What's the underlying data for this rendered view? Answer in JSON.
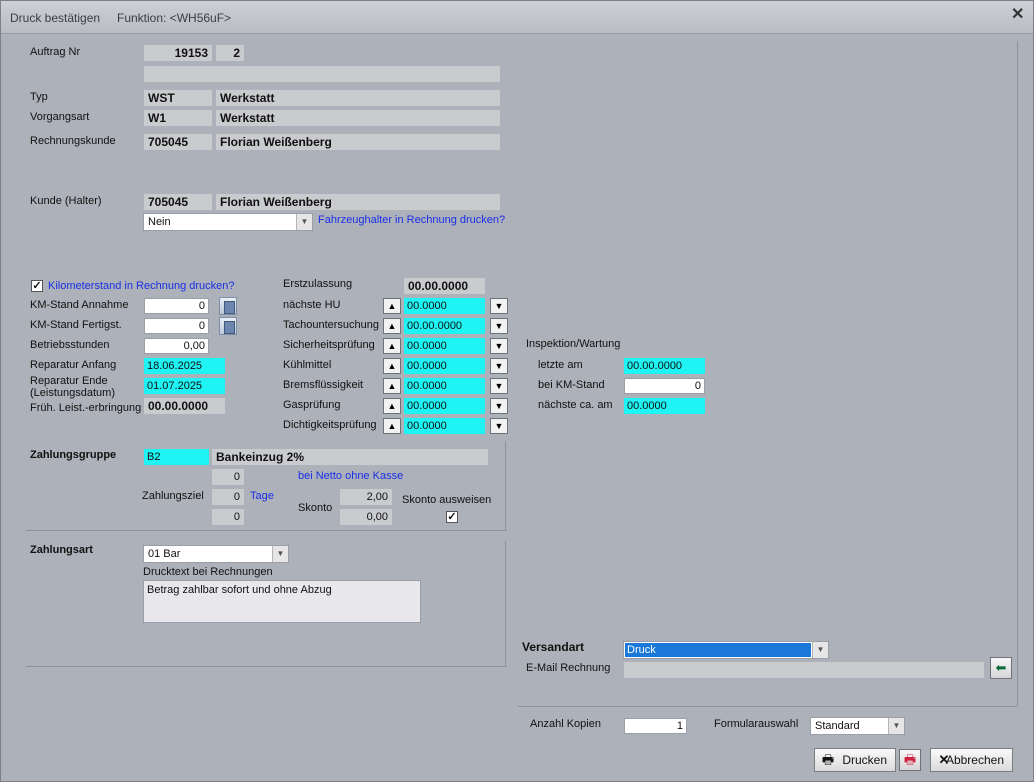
{
  "window": {
    "title": "Druck bestätigen",
    "function": "Funktion: <WH56uF>"
  },
  "auftrag": {
    "label": "Auftrag Nr",
    "nr": "19153",
    "sub": "2"
  },
  "typ": {
    "label": "Typ",
    "code": "WST",
    "name": "Werkstatt"
  },
  "vorgangsart": {
    "label": "Vorgangsart",
    "code": "W1",
    "name": "Werkstatt"
  },
  "rechnungskunde": {
    "label": "Rechnungskunde",
    "nr": "705045",
    "name": "Florian Weißenberg"
  },
  "kunde": {
    "label": "Kunde (Halter)",
    "nr": "705045",
    "name": "Florian Weißenberg",
    "halter_select": "Nein",
    "halter_link": "Fahrzeughalter in Rechnung drucken?"
  },
  "km": {
    "check_label": "Kilometerstand in Rechnung drucken?",
    "annahme_label": "KM-Stand Annahme",
    "annahme": "0",
    "fertig_label": "KM-Stand Fertigst.",
    "fertig": "0",
    "betrieb_label": "Betriebsstunden",
    "betrieb": "0,00",
    "rep_anfang_label": "Reparatur Anfang",
    "rep_anfang": "18.06.2025",
    "rep_ende_label1": "Reparatur Ende",
    "rep_ende_label2": "(Leistungsdatum)",
    "rep_ende": "01.07.2025",
    "frueh_label": "Früh. Leist.-erbringung",
    "frueh": "00.00.0000"
  },
  "pruefungen": {
    "erstzulassung_label": "Erstzulassung",
    "erstzulassung": "00.00.0000",
    "items": [
      {
        "label": "nächste HU",
        "value": "00.0000"
      },
      {
        "label": "Tachountersuchung",
        "value": "00.00.0000"
      },
      {
        "label": "Sicherheitsprüfung",
        "value": "00.0000"
      },
      {
        "label": "Kühlmittel",
        "value": "00.0000"
      },
      {
        "label": "Bremsflüssigkeit",
        "value": "00.0000"
      },
      {
        "label": "Gasprüfung",
        "value": "00.0000"
      },
      {
        "label": "Dichtigkeitsprüfung",
        "value": "00.0000"
      }
    ]
  },
  "inspektion": {
    "title": "Inspektion/Wartung",
    "letzte_label": "letzte am",
    "letzte": "00.00.0000",
    "km_label": "bei KM-Stand",
    "km": "0",
    "naechste_label": "nächste ca. am",
    "naechste": "00.0000"
  },
  "zahlungsgruppe": {
    "title": "Zahlungsgruppe",
    "code": "B2",
    "name": "Bankeinzug 2%",
    "netto_val": "0",
    "netto_link": "bei Netto ohne Kasse",
    "ziel_label": "Zahlungsziel",
    "ziel_val": "0",
    "ziel_unit": "Tage",
    "third_val": "0",
    "skonto_label": "Skonto",
    "skonto1": "2,00",
    "skonto2": "0,00",
    "skonto_ausweisen": "Skonto ausweisen"
  },
  "zahlungsart": {
    "title": "Zahlungsart",
    "select": "01  Bar",
    "drucktext_label": "Drucktext bei Rechnungen",
    "drucktext": "Betrag zahlbar sofort und ohne Abzug"
  },
  "versand": {
    "title": "Versandart",
    "select": "Druck",
    "email_label": "E-Mail Rechnung",
    "email": ""
  },
  "kopien": {
    "label": "Anzahl Kopien",
    "value": "1",
    "formular_label": "Formularauswahl",
    "formular": "Standard"
  },
  "buttons": {
    "drucken": "Drucken",
    "abbrechen": "Abbrechen"
  }
}
